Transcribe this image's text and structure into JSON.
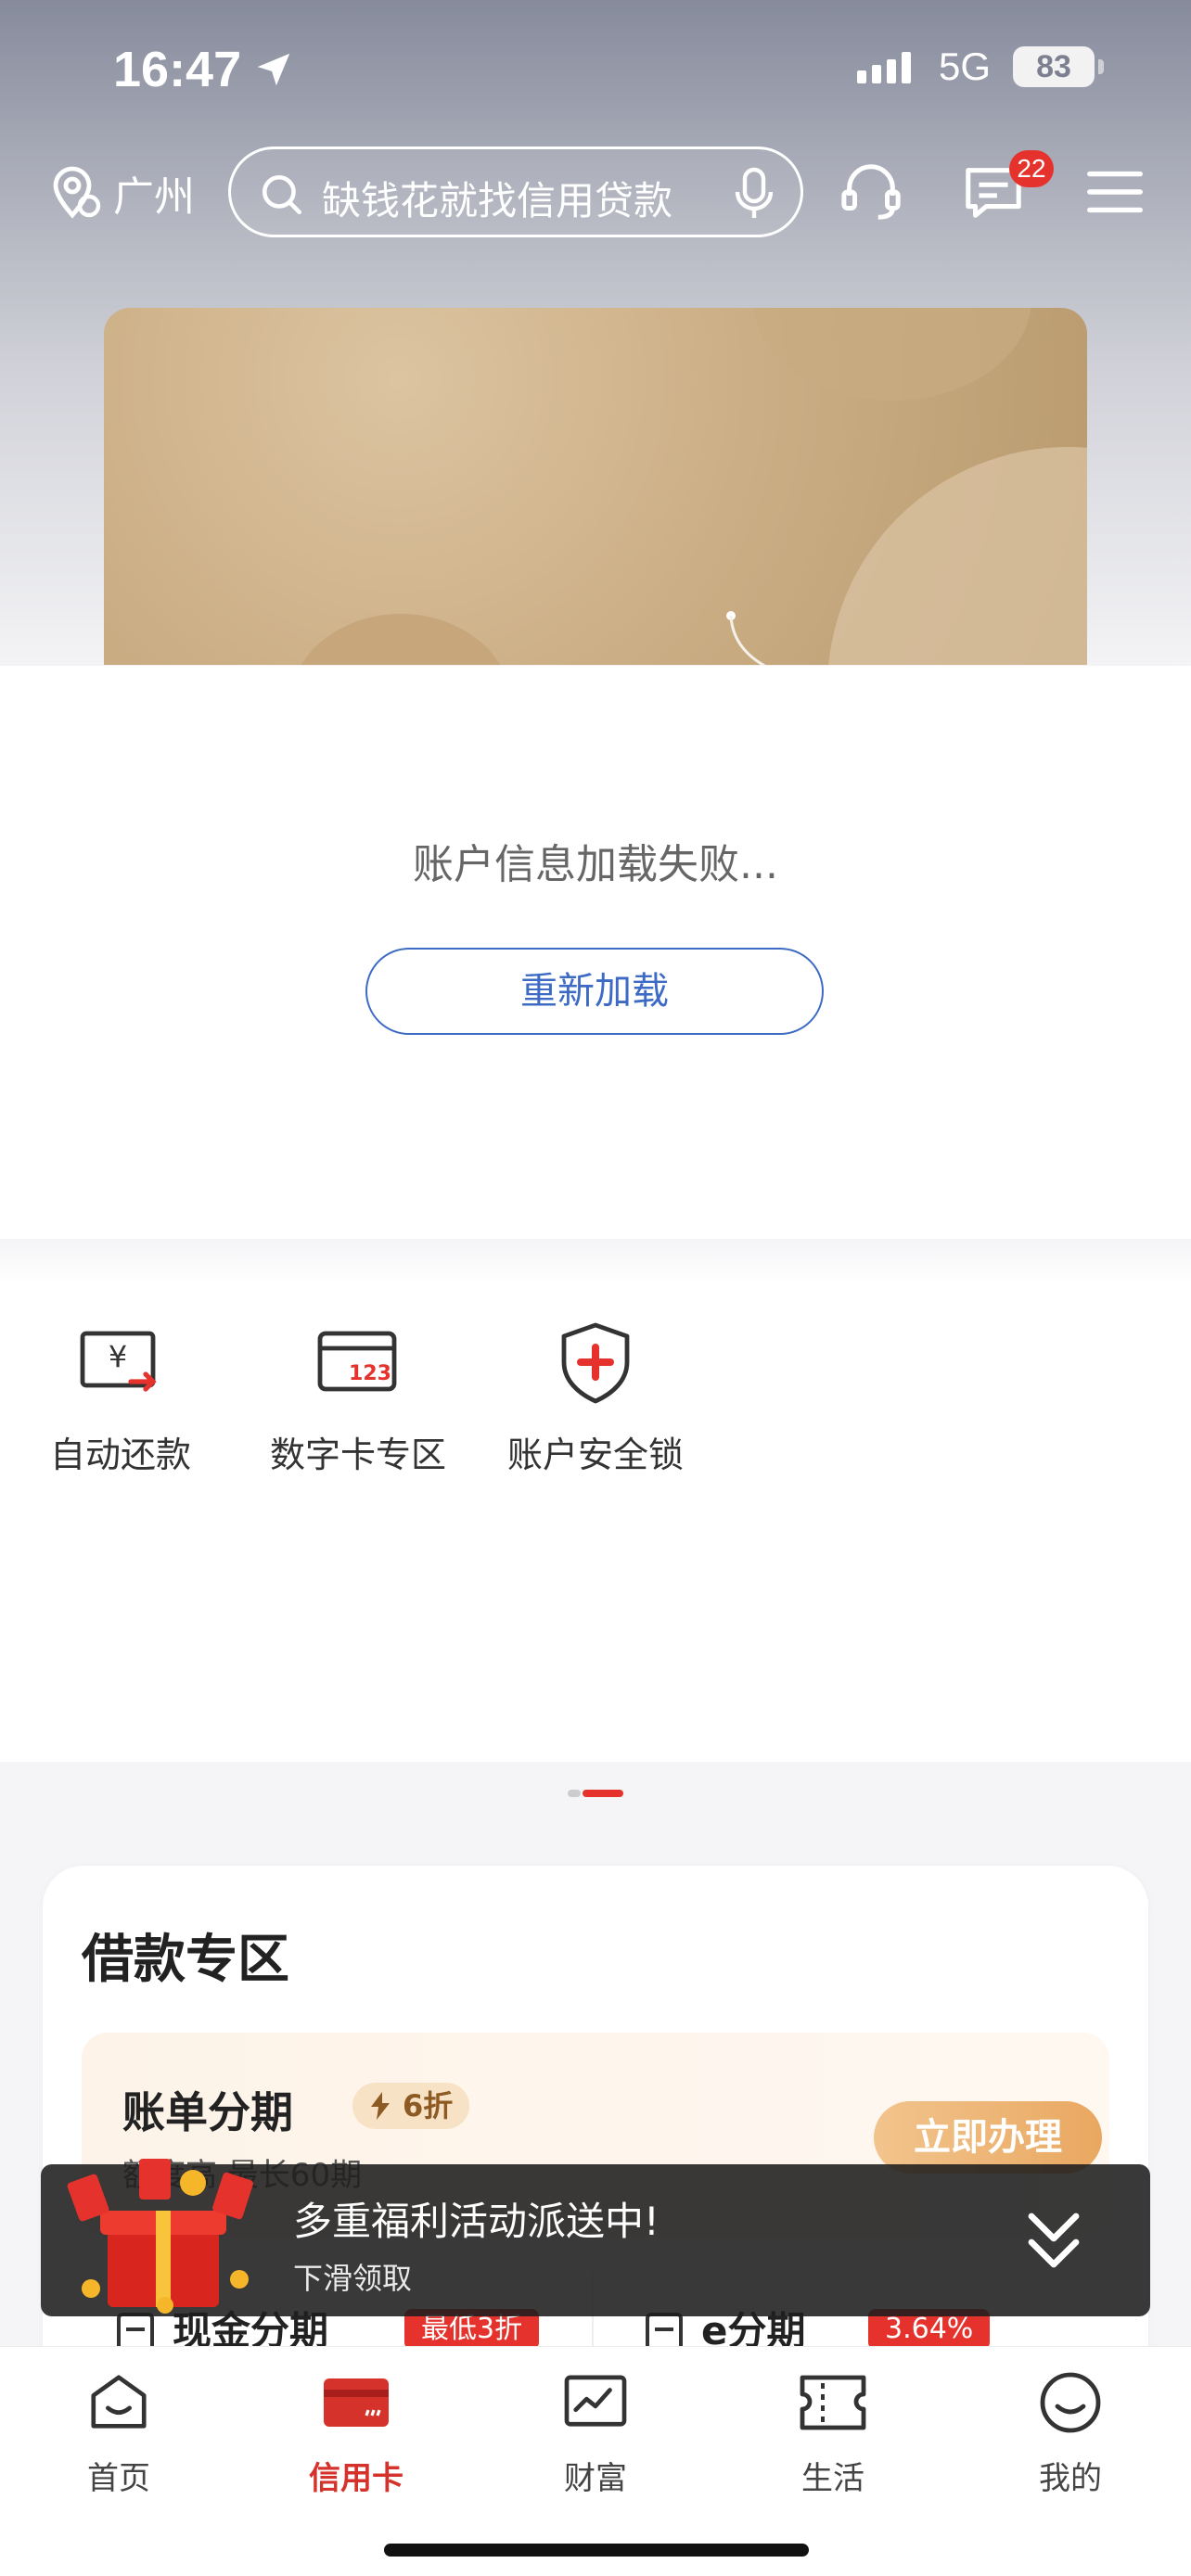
{
  "status_bar": {
    "time": "16:47",
    "network": "5G",
    "battery": "83"
  },
  "header": {
    "city": "广州",
    "search_placeholder": "缺钱花就找信用贷款",
    "message_badge": "22"
  },
  "account": {
    "error_message": "账户信息加载失败...",
    "reload_label": "重新加载"
  },
  "quick_actions": [
    {
      "label": "自动还款",
      "icon": "auto-repay-icon"
    },
    {
      "label": "数字卡专区",
      "icon": "digital-card-icon"
    },
    {
      "label": "账户安全锁",
      "icon": "security-lock-icon"
    }
  ],
  "loan": {
    "title": "借款专区",
    "card": {
      "title": "账单分期",
      "tag": "6折",
      "subtitle": "额度高 最长60期",
      "button": "立即办理"
    },
    "items": [
      {
        "title": "现金分期",
        "tag": "最低3折"
      },
      {
        "title": "e分期",
        "tag": "3.64%"
      }
    ]
  },
  "promo": {
    "title": "多重福利活动派送中!",
    "subtitle": "下滑领取"
  },
  "tabbar": {
    "items": [
      {
        "label": "首页"
      },
      {
        "label": "信用卡"
      },
      {
        "label": "财富"
      },
      {
        "label": "生活"
      },
      {
        "label": "我的"
      }
    ],
    "active_index": 1
  },
  "colors": {
    "accent": "#d6322c",
    "link": "#3c6ac4",
    "gold": "#e9a861"
  }
}
